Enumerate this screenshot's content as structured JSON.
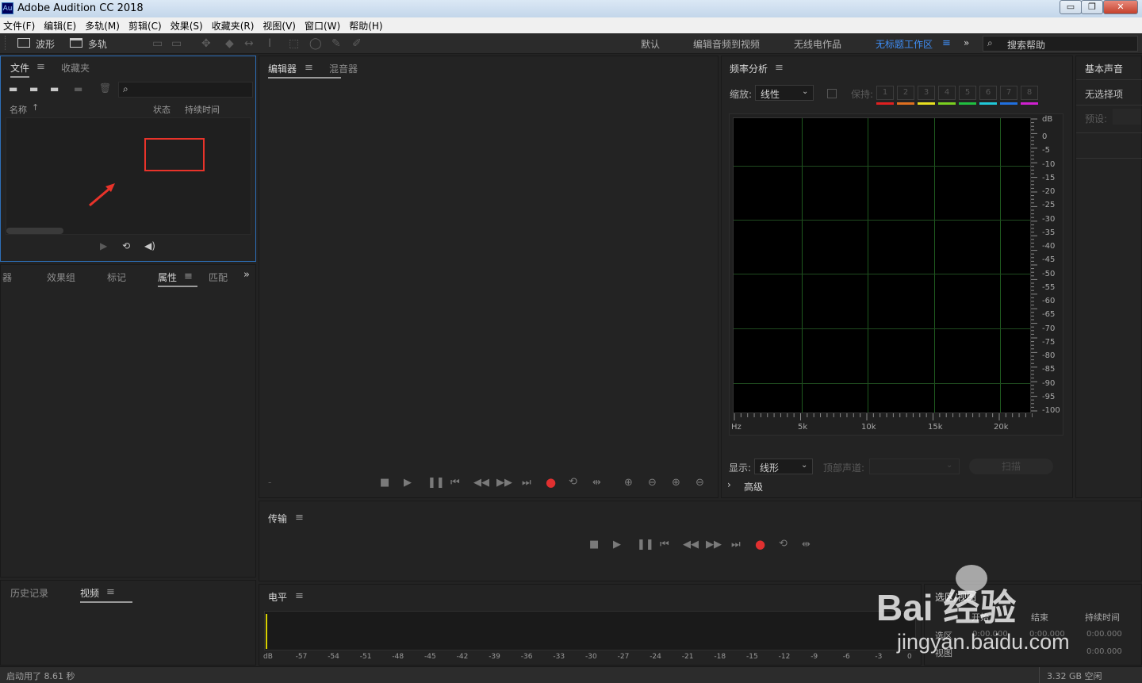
{
  "window": {
    "title": "Adobe Audition CC 2018",
    "icon_text": "Au",
    "minimize": "▭",
    "maximize": "❐",
    "close": "✕"
  },
  "menu": [
    "文件(F)",
    "编辑(E)",
    "多轨(M)",
    "剪辑(C)",
    "效果(S)",
    "收藏夹(R)",
    "视图(V)",
    "窗口(W)",
    "帮助(H)"
  ],
  "toolbar": {
    "waveform": "波形",
    "multitrack": "多轨",
    "workspaces": [
      "默认",
      "编辑音频到视频",
      "无线电作品",
      "无标题工作区"
    ],
    "more": "»",
    "search_placeholder": "搜索帮助"
  },
  "files_panel": {
    "tabs": [
      "文件",
      "收藏夹"
    ],
    "col_name": "名称",
    "col_status": "状态",
    "col_duration": "持续时间"
  },
  "lower_left_tabs": [
    "器",
    "效果组",
    "标记",
    "属性",
    "匹配"
  ],
  "history_tabs": [
    "历史记录",
    "视频"
  ],
  "editor_tabs": [
    "编辑器",
    "混音器"
  ],
  "freq": {
    "title": "频率分析",
    "zoom_label": "缩放:",
    "zoom_value": "线性",
    "keep_label": "保持:",
    "keep_slots": [
      "1",
      "2",
      "3",
      "4",
      "5",
      "6",
      "7",
      "8"
    ],
    "keep_colors": [
      "#e02020",
      "#e07020",
      "#e8e020",
      "#7ad020",
      "#20c040",
      "#20c8d8",
      "#2070e0",
      "#d020d0"
    ],
    "db_unit": "dB",
    "db_labels": [
      "0",
      "-5",
      "-10",
      "-15",
      "-20",
      "-25",
      "-30",
      "-35",
      "-40",
      "-45",
      "-50",
      "-55",
      "-60",
      "-65",
      "-70",
      "-75",
      "-80",
      "-85",
      "-90",
      "-95",
      "-100"
    ],
    "hz_labels": [
      "Hz",
      "5k",
      "10k",
      "15k",
      "20k"
    ],
    "display_label": "显示:",
    "display_value": "线形",
    "channel_label": "顶部声道:",
    "scan_label": "扫描",
    "advanced_label": "高级"
  },
  "essential": {
    "title": "基本声音",
    "no_selection": "无选择项",
    "preset_label": "预设:"
  },
  "transport": {
    "title": "传输"
  },
  "levels": {
    "title": "电平",
    "scale": [
      "dB",
      "-57",
      "-54",
      "-51",
      "-48",
      "-45",
      "-42",
      "-39",
      "-36",
      "-33",
      "-30",
      "-27",
      "-24",
      "-21",
      "-18",
      "-15",
      "-12",
      "-9",
      "-6",
      "-3",
      "0"
    ]
  },
  "selection_panel": {
    "title": "选区/视图",
    "col_start": "开始",
    "col_end": "结束",
    "col_duration": "持续时间",
    "row_selection": "选区",
    "row_view": "视图",
    "time_zero": "0:00.000"
  },
  "status": {
    "startup": "启动用了 8.61 秒",
    "disk": "3.32 GB 空闲"
  },
  "watermark": {
    "brand": "Bai 经验",
    "url": "jingyan.baidu.com"
  },
  "colors": {
    "accent": "#3f8ef5",
    "annotation": "#e8332a",
    "record": "#e03030"
  }
}
